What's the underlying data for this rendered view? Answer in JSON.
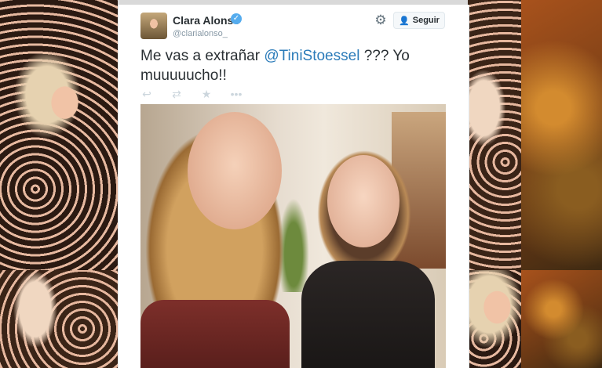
{
  "tweet": {
    "author_name": "Clara Alonso",
    "handle": "@clarialonso_",
    "follow_label": "Seguir",
    "text_before": "Me vas a extrañar ",
    "mention": "@TiniStoessel",
    "text_after": " ??? Yo muuuuucho!!",
    "icons": {
      "verified": "verified-badge-icon",
      "gear": "gear-icon",
      "follow": "add-user-icon",
      "reply": "reply-icon",
      "retweet": "retweet-icon",
      "favorite": "star-icon",
      "more": "more-icon"
    }
  },
  "colors": {
    "link": "#2b7bb9",
    "verified": "#55acee",
    "text": "#292f33",
    "muted": "#8899a6"
  }
}
